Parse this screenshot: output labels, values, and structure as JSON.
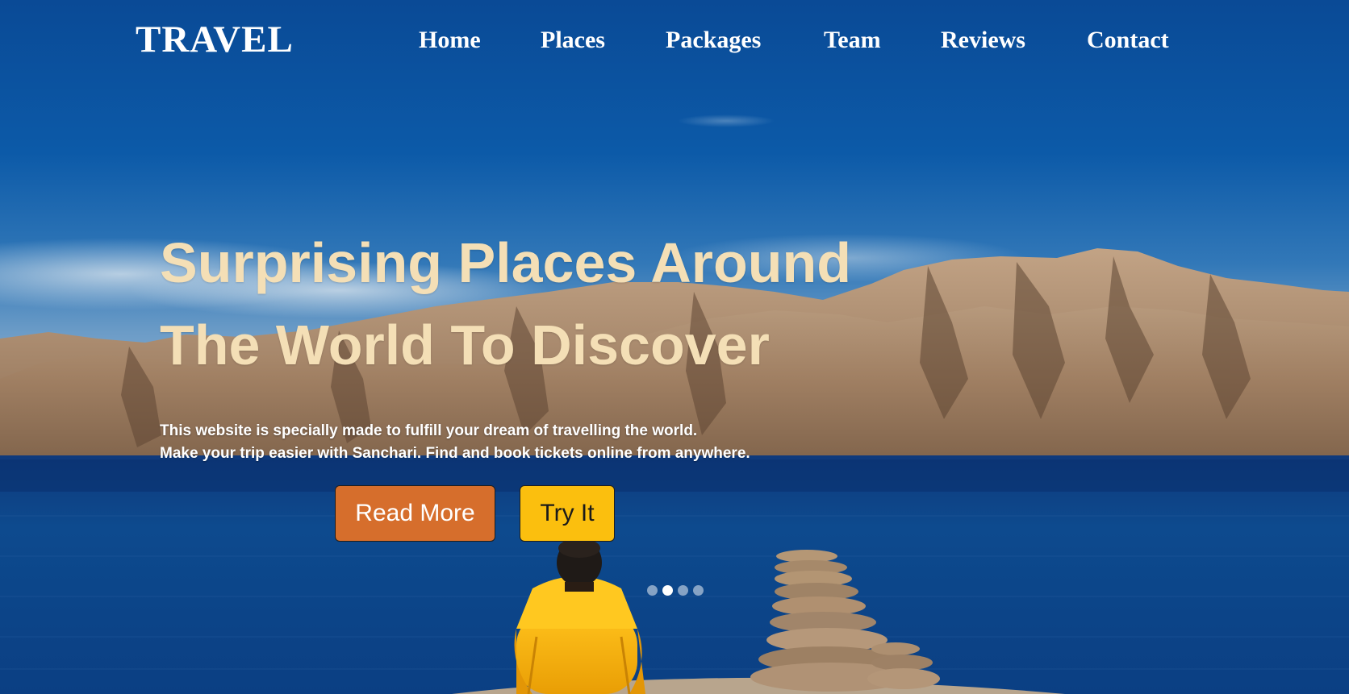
{
  "brand": {
    "logo": "TRAVEL"
  },
  "nav": {
    "items": [
      {
        "label": "Home"
      },
      {
        "label": "Places"
      },
      {
        "label": "Packages"
      },
      {
        "label": "Team"
      },
      {
        "label": "Reviews"
      },
      {
        "label": "Contact"
      }
    ]
  },
  "hero": {
    "headline_line1": "Surprising Places Around",
    "headline_line2": "The World To Discover",
    "description_line1": "This website is specially made to fulfill your dream of travelling the world.",
    "description_line2": "Make your trip easier with Sanchari. Find and book tickets online from anywhere.",
    "read_more_label": "Read More",
    "try_it_label": "Try It",
    "carousel": {
      "slide_count": 4,
      "active_index": 1
    }
  },
  "colors": {
    "headline": "#f4dfb6",
    "read_more_bg": "#d66e2c",
    "try_it_bg": "#fbbf0e",
    "sky_top": "#0a4a96",
    "lake": "#0b3f83"
  }
}
